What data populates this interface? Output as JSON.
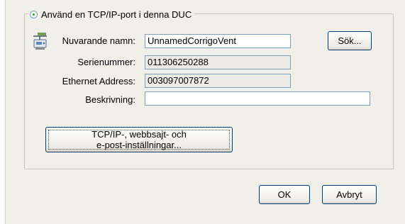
{
  "dialog": {
    "group_label": "Använd en TCP/IP-port i denna DUC",
    "name_label": "Nuvarande namn:",
    "name_value": "UnnamedCorrigoVent",
    "serial_label": "Serienummer:",
    "serial_value": "011306250288",
    "ethernet_label": "Ethernet Address:",
    "ethernet_value": "003097007872",
    "description_label": "Beskrivning:",
    "description_value": "",
    "search_button": "Sök...",
    "settings_button_line1": "TCP/IP-, webbsajt- och",
    "settings_button_line2": "e-post-inställningar...",
    "ok_button": "OK",
    "cancel_button": "Avbryt"
  }
}
